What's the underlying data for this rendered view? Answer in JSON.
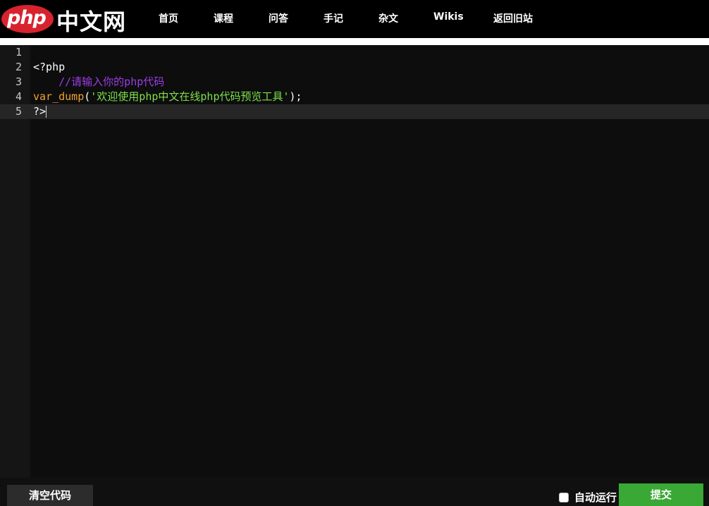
{
  "logo": {
    "php": "php",
    "cn": "中文网"
  },
  "nav": [
    "首页",
    "课程",
    "问答",
    "手记",
    "杂文",
    "Wikis",
    "返回旧站"
  ],
  "editor": {
    "line_numbers": [
      "1",
      "2",
      "3",
      "4",
      "5"
    ],
    "active_line": 5,
    "lines": {
      "l2": "<?php",
      "l3": "    //请输入你的php代码",
      "l4_func": "var_dump",
      "l4_open": "(",
      "l4_str": "'欢迎使用php中文在线php代码预览工具'",
      "l4_close": ");",
      "l5": "?>"
    }
  },
  "bottom": {
    "clear_label": "清空代码",
    "auto_run_label": "自动运行",
    "auto_run_checked": false,
    "submit_label": "提交"
  },
  "colors": {
    "logo_red": "#d8232f",
    "comment": "#9b3de6",
    "function": "#f0a030",
    "string": "#7ee04a",
    "submit_green": "#3aa835"
  }
}
